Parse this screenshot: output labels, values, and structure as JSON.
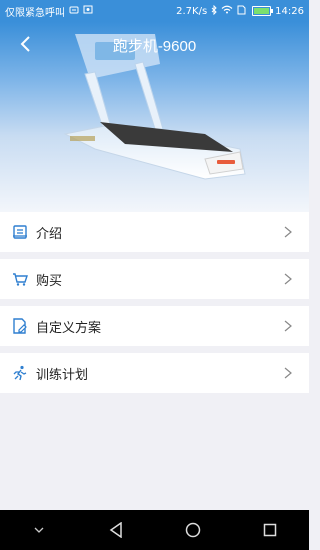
{
  "status_bar": {
    "carrier": "仅限紧急呼叫",
    "speed": "2.7K/s",
    "time": "14:26",
    "battery_level": 0.9,
    "icons": [
      "sim-icon",
      "screenshot-icon",
      "bluetooth-icon",
      "wifi-icon",
      "sim-card-icon",
      "battery-icon"
    ]
  },
  "header": {
    "title": "跑步机-9600",
    "back_icon": "chevron-left-icon"
  },
  "menu": {
    "items": [
      {
        "label": "介绍",
        "icon": "intro-icon"
      },
      {
        "label": "购买",
        "icon": "cart-icon"
      },
      {
        "label": "自定义方案",
        "icon": "custom-plan-icon"
      },
      {
        "label": "训练计划",
        "icon": "training-icon"
      }
    ]
  },
  "nav_bar": {
    "buttons": [
      "collapse-icon",
      "back-triangle-icon",
      "home-circle-icon",
      "recent-square-icon"
    ]
  },
  "colors": {
    "accent": "#3a8fd9",
    "icon": "#2f7fd0",
    "background": "#f0f0f5"
  }
}
